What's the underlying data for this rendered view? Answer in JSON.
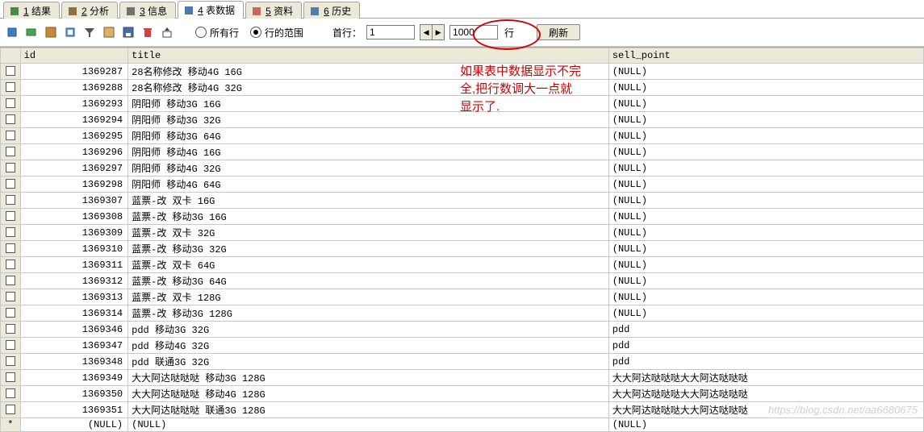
{
  "tabs": [
    {
      "num": "1",
      "label": "结果",
      "active": false,
      "icon": "result-icon",
      "color": "#2d7a2d"
    },
    {
      "num": "2",
      "label": "分析",
      "active": false,
      "icon": "analyze-icon",
      "color": "#7a5c2d"
    },
    {
      "num": "3",
      "label": "信息",
      "active": false,
      "icon": "info-icon",
      "color": "#5a5a5a"
    },
    {
      "num": "4",
      "label": "表数据",
      "active": true,
      "icon": "tabledata-icon",
      "color": "#2d5fa8"
    },
    {
      "num": "5",
      "label": "资料",
      "active": false,
      "icon": "profile-icon",
      "color": "#c05050"
    },
    {
      "num": "6",
      "label": "历史",
      "active": false,
      "icon": "history-icon",
      "color": "#3a6aa0"
    }
  ],
  "toolbar": {
    "radios": {
      "all": "所有行",
      "range": "行的范围",
      "checked": "range"
    },
    "first_label": "首行：",
    "first_value": "1",
    "rows_value": "1000",
    "rows_suffix": "行",
    "refresh": "刷新"
  },
  "annotation": {
    "line1": "如果表中数据显示不完",
    "line2": "全,把行数调大一点就",
    "line3": "显示了."
  },
  "columns": [
    "id",
    "title",
    "sell_point"
  ],
  "rows": [
    {
      "id": "1369287",
      "title": "28名称修改 移动4G 16G",
      "sell": "(NULL)"
    },
    {
      "id": "1369288",
      "title": "28名称修改 移动4G 32G",
      "sell": "(NULL)"
    },
    {
      "id": "1369293",
      "title": "阴阳师 移动3G 16G",
      "sell": "(NULL)"
    },
    {
      "id": "1369294",
      "title": "阴阳师 移动3G 32G",
      "sell": "(NULL)"
    },
    {
      "id": "1369295",
      "title": "阴阳师 移动3G 64G",
      "sell": "(NULL)"
    },
    {
      "id": "1369296",
      "title": "阴阳师 移动4G 16G",
      "sell": "(NULL)"
    },
    {
      "id": "1369297",
      "title": "阴阳师 移动4G 32G",
      "sell": "(NULL)"
    },
    {
      "id": "1369298",
      "title": "阴阳师 移动4G 64G",
      "sell": "(NULL)"
    },
    {
      "id": "1369307",
      "title": "蓝票-改 双卡 16G",
      "sell": "(NULL)"
    },
    {
      "id": "1369308",
      "title": "蓝票-改 移动3G 16G",
      "sell": "(NULL)"
    },
    {
      "id": "1369309",
      "title": "蓝票-改 双卡 32G",
      "sell": "(NULL)"
    },
    {
      "id": "1369310",
      "title": "蓝票-改 移动3G 32G",
      "sell": "(NULL)"
    },
    {
      "id": "1369311",
      "title": "蓝票-改 双卡 64G",
      "sell": "(NULL)"
    },
    {
      "id": "1369312",
      "title": "蓝票-改 移动3G 64G",
      "sell": "(NULL)"
    },
    {
      "id": "1369313",
      "title": "蓝票-改 双卡 128G",
      "sell": "(NULL)"
    },
    {
      "id": "1369314",
      "title": "蓝票-改 移动3G 128G",
      "sell": "(NULL)"
    },
    {
      "id": "1369346",
      "title": "pdd 移动3G 32G",
      "sell": "pdd"
    },
    {
      "id": "1369347",
      "title": "pdd 移动4G 32G",
      "sell": "pdd"
    },
    {
      "id": "1369348",
      "title": "pdd 联通3G 32G",
      "sell": "pdd"
    },
    {
      "id": "1369349",
      "title": "大大阿达哒哒哒 移动3G 128G",
      "sell": "大大阿达哒哒哒大大阿达哒哒哒"
    },
    {
      "id": "1369350",
      "title": "大大阿达哒哒哒 移动4G 128G",
      "sell": "大大阿达哒哒哒大大阿达哒哒哒"
    },
    {
      "id": "1369351",
      "title": "大大阿达哒哒哒 联通3G 128G",
      "sell": "大大阿达哒哒哒大大阿达哒哒哒"
    }
  ],
  "null_row": {
    "id": "(NULL)",
    "title": "(NULL)",
    "sell": "(NULL)"
  },
  "watermark": "https://blog.csdn.net/aa6680675"
}
